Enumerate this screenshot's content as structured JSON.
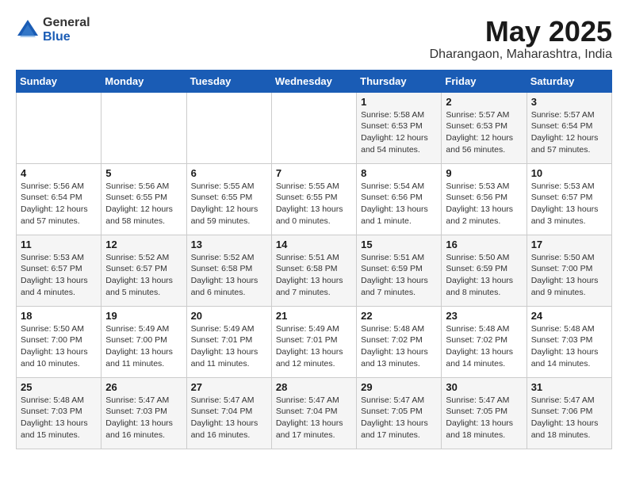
{
  "header": {
    "logo_general": "General",
    "logo_blue": "Blue",
    "title": "May 2025",
    "location": "Dharangaon, Maharashtra, India"
  },
  "weekdays": [
    "Sunday",
    "Monday",
    "Tuesday",
    "Wednesday",
    "Thursday",
    "Friday",
    "Saturday"
  ],
  "weeks": [
    [
      {
        "day": "",
        "info": ""
      },
      {
        "day": "",
        "info": ""
      },
      {
        "day": "",
        "info": ""
      },
      {
        "day": "",
        "info": ""
      },
      {
        "day": "1",
        "info": "Sunrise: 5:58 AM\nSunset: 6:53 PM\nDaylight: 12 hours\nand 54 minutes."
      },
      {
        "day": "2",
        "info": "Sunrise: 5:57 AM\nSunset: 6:53 PM\nDaylight: 12 hours\nand 56 minutes."
      },
      {
        "day": "3",
        "info": "Sunrise: 5:57 AM\nSunset: 6:54 PM\nDaylight: 12 hours\nand 57 minutes."
      }
    ],
    [
      {
        "day": "4",
        "info": "Sunrise: 5:56 AM\nSunset: 6:54 PM\nDaylight: 12 hours\nand 57 minutes."
      },
      {
        "day": "5",
        "info": "Sunrise: 5:56 AM\nSunset: 6:55 PM\nDaylight: 12 hours\nand 58 minutes."
      },
      {
        "day": "6",
        "info": "Sunrise: 5:55 AM\nSunset: 6:55 PM\nDaylight: 12 hours\nand 59 minutes."
      },
      {
        "day": "7",
        "info": "Sunrise: 5:55 AM\nSunset: 6:55 PM\nDaylight: 13 hours\nand 0 minutes."
      },
      {
        "day": "8",
        "info": "Sunrise: 5:54 AM\nSunset: 6:56 PM\nDaylight: 13 hours\nand 1 minute."
      },
      {
        "day": "9",
        "info": "Sunrise: 5:53 AM\nSunset: 6:56 PM\nDaylight: 13 hours\nand 2 minutes."
      },
      {
        "day": "10",
        "info": "Sunrise: 5:53 AM\nSunset: 6:57 PM\nDaylight: 13 hours\nand 3 minutes."
      }
    ],
    [
      {
        "day": "11",
        "info": "Sunrise: 5:53 AM\nSunset: 6:57 PM\nDaylight: 13 hours\nand 4 minutes."
      },
      {
        "day": "12",
        "info": "Sunrise: 5:52 AM\nSunset: 6:57 PM\nDaylight: 13 hours\nand 5 minutes."
      },
      {
        "day": "13",
        "info": "Sunrise: 5:52 AM\nSunset: 6:58 PM\nDaylight: 13 hours\nand 6 minutes."
      },
      {
        "day": "14",
        "info": "Sunrise: 5:51 AM\nSunset: 6:58 PM\nDaylight: 13 hours\nand 7 minutes."
      },
      {
        "day": "15",
        "info": "Sunrise: 5:51 AM\nSunset: 6:59 PM\nDaylight: 13 hours\nand 7 minutes."
      },
      {
        "day": "16",
        "info": "Sunrise: 5:50 AM\nSunset: 6:59 PM\nDaylight: 13 hours\nand 8 minutes."
      },
      {
        "day": "17",
        "info": "Sunrise: 5:50 AM\nSunset: 7:00 PM\nDaylight: 13 hours\nand 9 minutes."
      }
    ],
    [
      {
        "day": "18",
        "info": "Sunrise: 5:50 AM\nSunset: 7:00 PM\nDaylight: 13 hours\nand 10 minutes."
      },
      {
        "day": "19",
        "info": "Sunrise: 5:49 AM\nSunset: 7:00 PM\nDaylight: 13 hours\nand 11 minutes."
      },
      {
        "day": "20",
        "info": "Sunrise: 5:49 AM\nSunset: 7:01 PM\nDaylight: 13 hours\nand 11 minutes."
      },
      {
        "day": "21",
        "info": "Sunrise: 5:49 AM\nSunset: 7:01 PM\nDaylight: 13 hours\nand 12 minutes."
      },
      {
        "day": "22",
        "info": "Sunrise: 5:48 AM\nSunset: 7:02 PM\nDaylight: 13 hours\nand 13 minutes."
      },
      {
        "day": "23",
        "info": "Sunrise: 5:48 AM\nSunset: 7:02 PM\nDaylight: 13 hours\nand 14 minutes."
      },
      {
        "day": "24",
        "info": "Sunrise: 5:48 AM\nSunset: 7:03 PM\nDaylight: 13 hours\nand 14 minutes."
      }
    ],
    [
      {
        "day": "25",
        "info": "Sunrise: 5:48 AM\nSunset: 7:03 PM\nDaylight: 13 hours\nand 15 minutes."
      },
      {
        "day": "26",
        "info": "Sunrise: 5:47 AM\nSunset: 7:03 PM\nDaylight: 13 hours\nand 16 minutes."
      },
      {
        "day": "27",
        "info": "Sunrise: 5:47 AM\nSunset: 7:04 PM\nDaylight: 13 hours\nand 16 minutes."
      },
      {
        "day": "28",
        "info": "Sunrise: 5:47 AM\nSunset: 7:04 PM\nDaylight: 13 hours\nand 17 minutes."
      },
      {
        "day": "29",
        "info": "Sunrise: 5:47 AM\nSunset: 7:05 PM\nDaylight: 13 hours\nand 17 minutes."
      },
      {
        "day": "30",
        "info": "Sunrise: 5:47 AM\nSunset: 7:05 PM\nDaylight: 13 hours\nand 18 minutes."
      },
      {
        "day": "31",
        "info": "Sunrise: 5:47 AM\nSunset: 7:06 PM\nDaylight: 13 hours\nand 18 minutes."
      }
    ]
  ]
}
